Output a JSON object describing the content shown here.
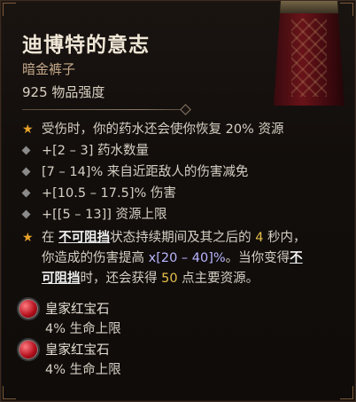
{
  "item": {
    "name": "迪博特的意志",
    "type": "暗金裤子",
    "power": "925 物品强度"
  },
  "affixes": [
    {
      "kind": "star",
      "text": "受伤时，你的药水还会使你恢复 20% 资源"
    },
    {
      "kind": "diamond",
      "text": "+[2 – 3] 药水数量"
    },
    {
      "kind": "diamond",
      "text": "[7 – 14]% 来自近距敌人的伤害减免"
    },
    {
      "kind": "diamond",
      "text": "+[10.5 – 17.5]% 伤害"
    },
    {
      "kind": "diamond",
      "text": "+[[5 – 13]] 资源上限"
    }
  ],
  "unique_power": {
    "p1": "在 ",
    "kw1": "不可阻挡",
    "p2": "状态持续期间及其之后的 ",
    "n1": "4",
    "p3": " 秒内，",
    "p4": "你造成的伤害提高 ",
    "n2": "x[20 – 40]%",
    "p5": "。当你变得",
    "kw2a": "不",
    "kw2b": "可阻挡",
    "p6": "时，还会获得 ",
    "n3": "50",
    "p7": " 点主要资源。"
  },
  "gems": [
    {
      "name": "皇家红宝石",
      "stat": "4% 生命上限"
    },
    {
      "name": "皇家红宝石",
      "stat": "4% 生命上限"
    }
  ],
  "colors": {
    "accent": "#e7a22a",
    "number": "#e7c04a",
    "range": "#b8b6ff",
    "ruby": "#b10e1a"
  }
}
